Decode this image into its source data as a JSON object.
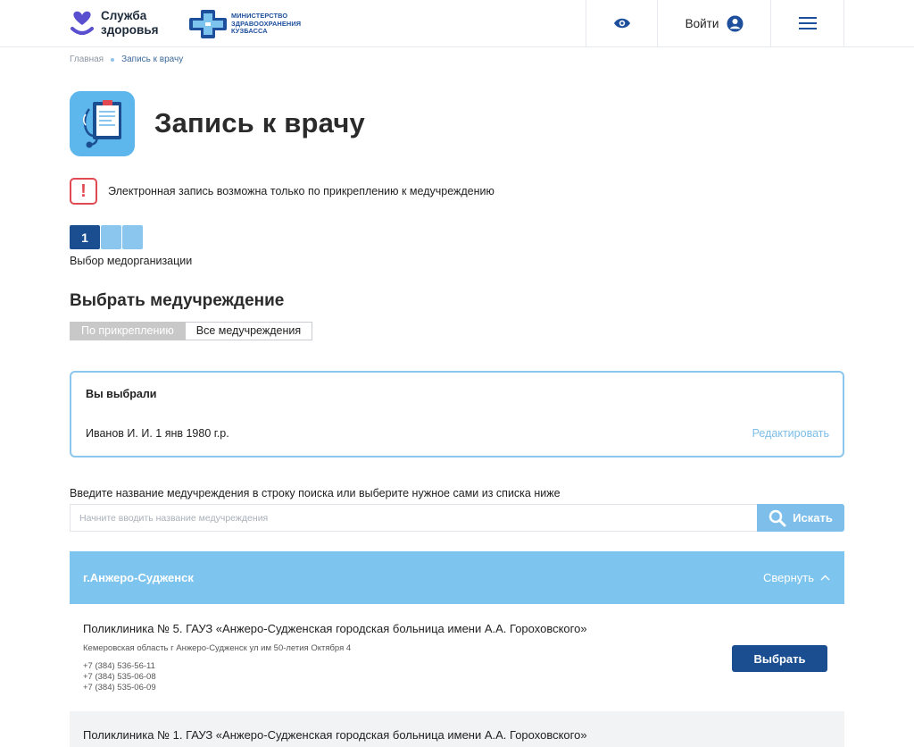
{
  "header": {
    "logo_text_line1": "Служба",
    "logo_text_line2": "здоровья",
    "ministry_line1": "МИНИСТЕРСТВО",
    "ministry_line2": "ЗДРАВООХРАНЕНИЯ",
    "ministry_line3": "КУЗБАССА",
    "login_label": "Войти",
    "icons": {
      "accessibility": "eye-icon",
      "user": "user-icon",
      "menu": "hamburger-icon"
    }
  },
  "breadcrumb": {
    "home": "Главная",
    "current": "Запись к врачу"
  },
  "page": {
    "title": "Запись к врачу",
    "warning": "Электронная запись возможна только по прикреплению к медучреждению"
  },
  "steps": {
    "current_number": "1",
    "total": 3,
    "current_label": "Выбор медорганизации"
  },
  "section": {
    "title": "Выбрать медучреждение",
    "tabs": [
      "По прикреплению",
      "Все медучреждения"
    ],
    "active_tab": "По прикреплению"
  },
  "chosen": {
    "heading": "Вы выбрали",
    "person": "Иванов И. И. 1 янв 1980 г.р.",
    "edit_label": "Редактировать"
  },
  "search": {
    "hint": "Введите название медучреждения в строку поиска или выберите нужное сами из списка ниже",
    "placeholder": "Начните вводить название медучреждения",
    "button_label": "Искать"
  },
  "city_group": {
    "name": "г.Анжеро-Судженск",
    "collapse_label": "Свернуть"
  },
  "clinics": [
    {
      "name": "Поликлиника № 5. ГАУЗ «Анжеро-Судженская городская больница имени А.А. Гороховского»",
      "address": "Кемеровская область г Анжеро-Судженск ул им 50-летия Октября 4",
      "phones": [
        "+7 (384) 536-56-11",
        "+7 (384) 535-06-08",
        "+7 (384) 535-06-09"
      ],
      "button_label": "Выбрать"
    },
    {
      "name": "Поликлиника № 1. ГАУЗ «Анжеро-Судженская городская больница имени А.А. Гороховского»"
    }
  ],
  "colors": {
    "brand_dark": "#1a4e91",
    "brand_light": "#7dc4ee",
    "warning": "#e14a52"
  }
}
